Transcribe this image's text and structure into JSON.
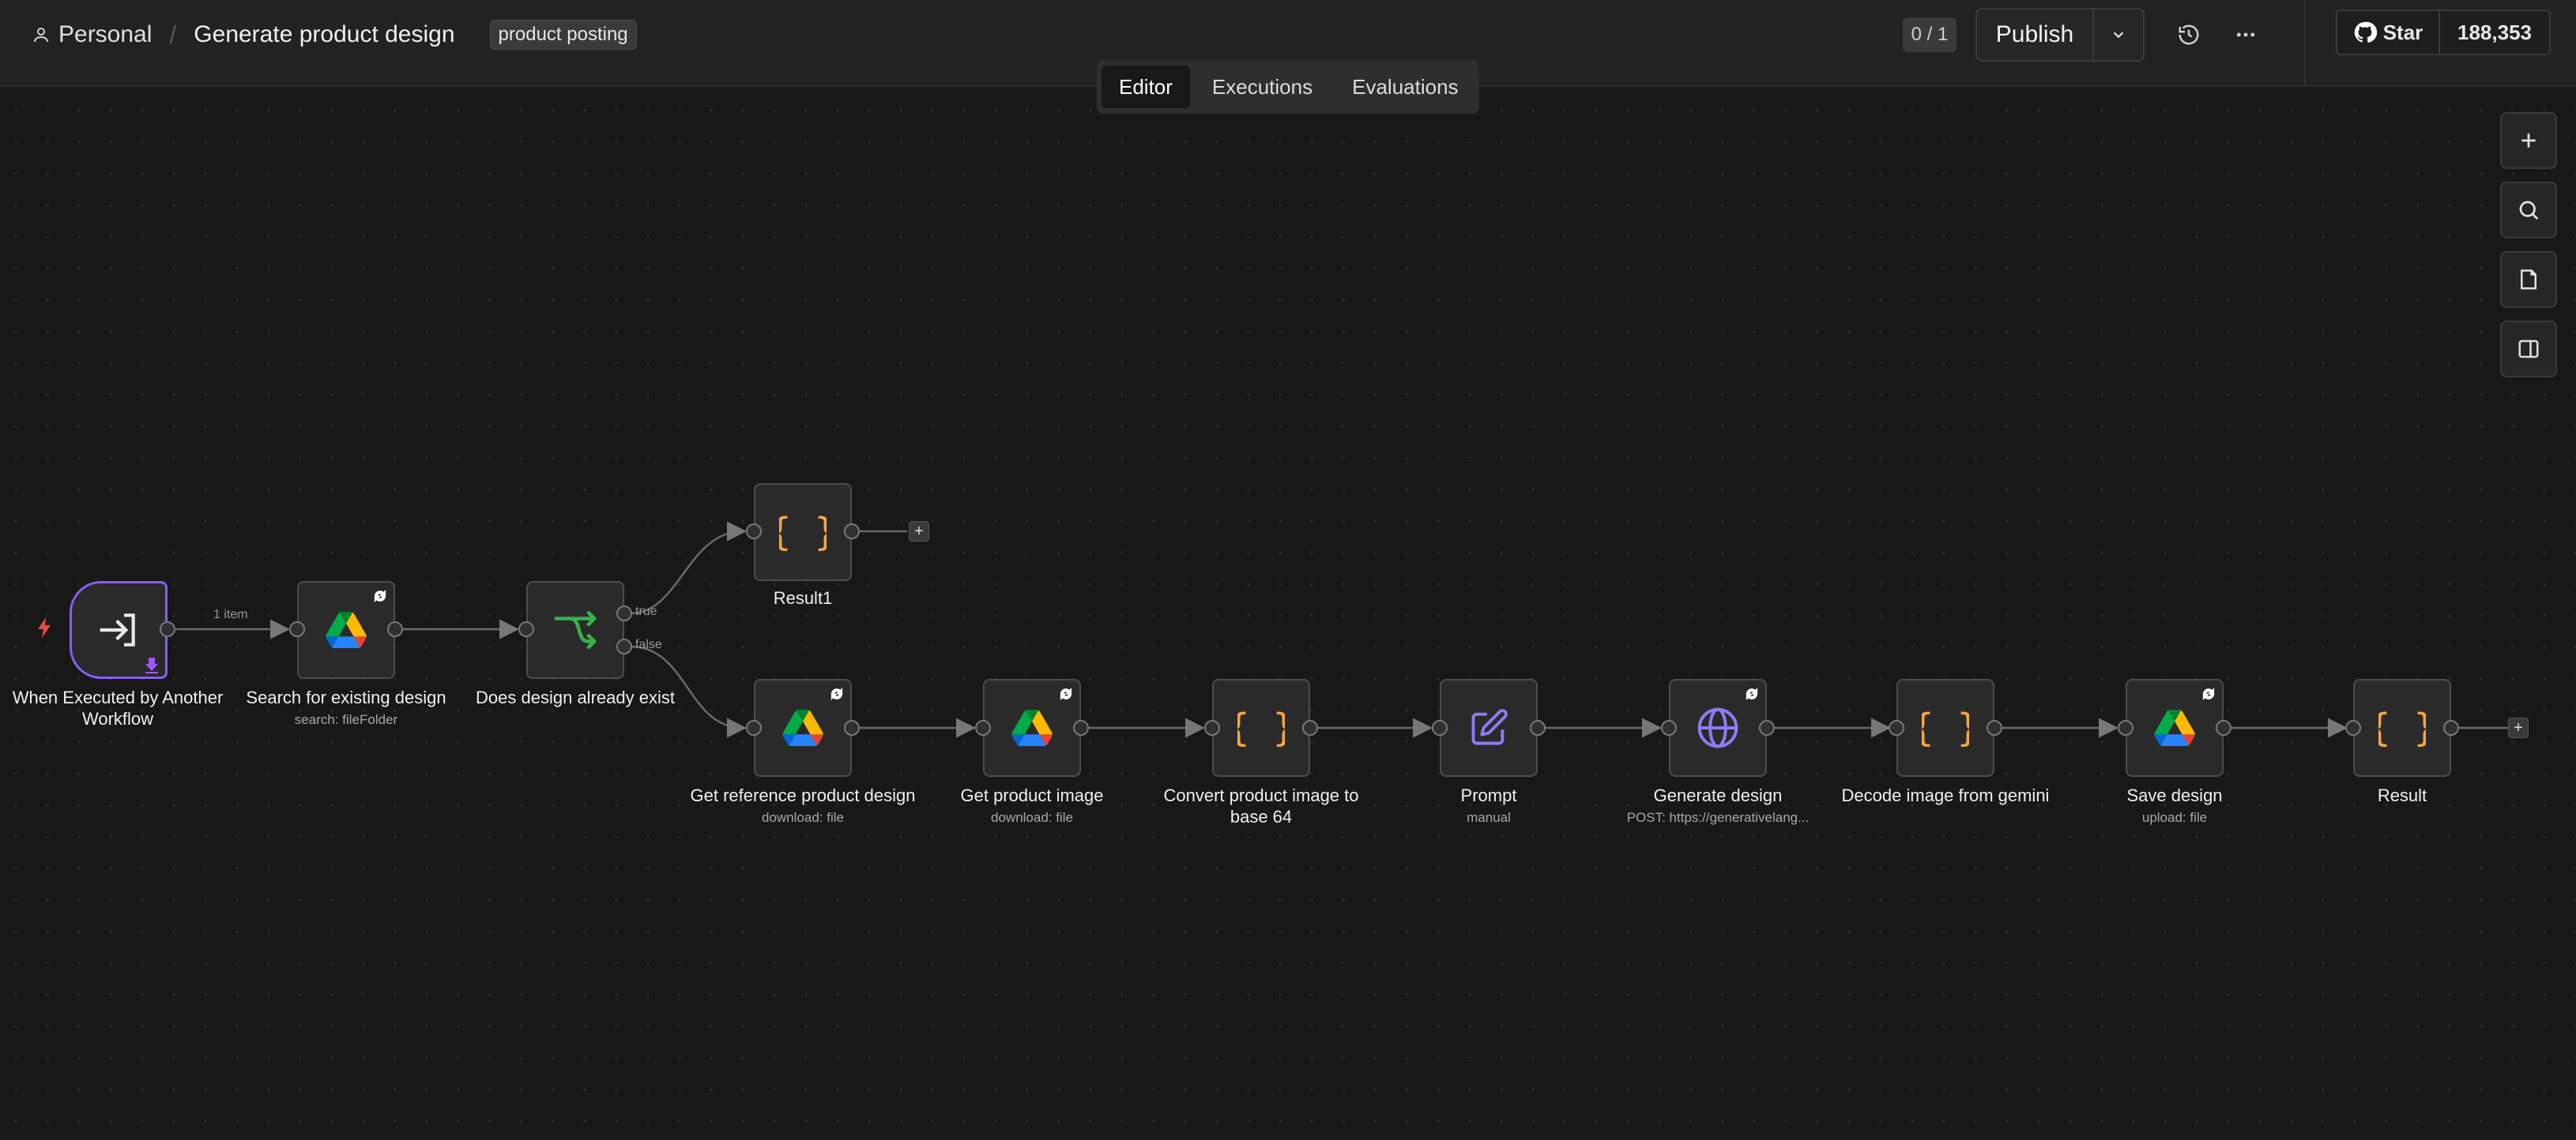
{
  "header": {
    "project": "Personal",
    "workflow_name": "Generate product design",
    "tag": "product posting",
    "counter": "0 / 1",
    "publish_label": "Publish",
    "github_star_label": "Star",
    "github_stars": "188,353"
  },
  "tabs": [
    {
      "label": "Editor",
      "active": true
    },
    {
      "label": "Executions",
      "active": false
    },
    {
      "label": "Evaluations",
      "active": false
    }
  ],
  "edge_labels": {
    "items_count": "1 item",
    "true_branch": "true",
    "false_branch": "false"
  },
  "nodes": [
    {
      "id": "trigger",
      "title": "When Executed by Another Workflow",
      "subtitle": "",
      "icon": "arrow-into-box-icon"
    },
    {
      "id": "search",
      "title": "Search for existing design",
      "subtitle": "search: fileFolder",
      "icon": "google-drive-icon"
    },
    {
      "id": "if",
      "title": "Does design already exist",
      "subtitle": "",
      "icon": "branch-icon"
    },
    {
      "id": "result1",
      "title": "Result1",
      "subtitle": "",
      "icon": "code-braces-icon"
    },
    {
      "id": "get-ref",
      "title": "Get reference product design",
      "subtitle": "download: file",
      "icon": "google-drive-icon"
    },
    {
      "id": "get-img",
      "title": "Get product image",
      "subtitle": "download: file",
      "icon": "google-drive-icon"
    },
    {
      "id": "convert",
      "title": "Convert product image to base 64",
      "subtitle": "",
      "icon": "code-braces-icon"
    },
    {
      "id": "prompt",
      "title": "Prompt",
      "subtitle": "manual",
      "icon": "pencil-square-icon"
    },
    {
      "id": "generate",
      "title": "Generate design",
      "subtitle": "POST: https://generativelang...",
      "icon": "globe-icon"
    },
    {
      "id": "decode",
      "title": "Decode image from gemini",
      "subtitle": "",
      "icon": "code-braces-icon"
    },
    {
      "id": "save",
      "title": "Save design",
      "subtitle": "upload: file",
      "icon": "google-drive-icon"
    },
    {
      "id": "result",
      "title": "Result",
      "subtitle": "",
      "icon": "code-braces-icon"
    }
  ],
  "colors": {
    "trigger_border": "#8a5cf6",
    "code_icon": "#f5a742",
    "branch_icon": "#36b24a",
    "prompt_icon": "#8b7cf6",
    "http_icon": "#8b7cf6",
    "bolt": "#ea4b3c"
  }
}
